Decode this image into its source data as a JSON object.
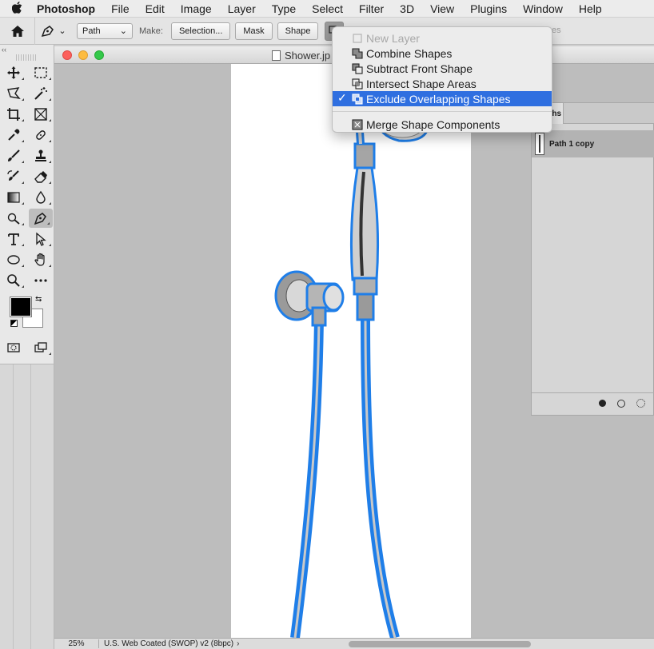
{
  "menubar": {
    "app_name": "Photoshop",
    "items": [
      "File",
      "Edit",
      "Image",
      "Layer",
      "Type",
      "Select",
      "Filter",
      "3D",
      "View",
      "Plugins",
      "Window",
      "Help"
    ]
  },
  "options": {
    "mode_value": "Path",
    "make_label": "Make:",
    "selection_label": "Selection...",
    "mask_label": "Mask",
    "shape_label": "Shape",
    "faded_text": "es"
  },
  "document": {
    "title": "Shower.jp",
    "zoom": "25%",
    "profile": "U.S. Web Coated (SWOP) v2 (8bpc)"
  },
  "paths_panel": {
    "tab_label": "ths",
    "path_name": "Path 1 copy"
  },
  "dropdown": {
    "items": [
      {
        "label": "New Layer",
        "disabled": true,
        "selected": false
      },
      {
        "label": "Combine Shapes",
        "disabled": false,
        "selected": false
      },
      {
        "label": "Subtract Front Shape",
        "disabled": false,
        "selected": false
      },
      {
        "label": "Intersect Shape Areas",
        "disabled": false,
        "selected": false
      },
      {
        "label": "Exclude Overlapping Shapes",
        "disabled": false,
        "selected": true
      }
    ],
    "merge_label": "Merge Shape Components",
    "check_mark": "✓"
  },
  "colors": {
    "accent": "#2f6fe0",
    "path_blue": "#1f7ee8",
    "foreground": "#000000",
    "background": "#ffffff"
  }
}
